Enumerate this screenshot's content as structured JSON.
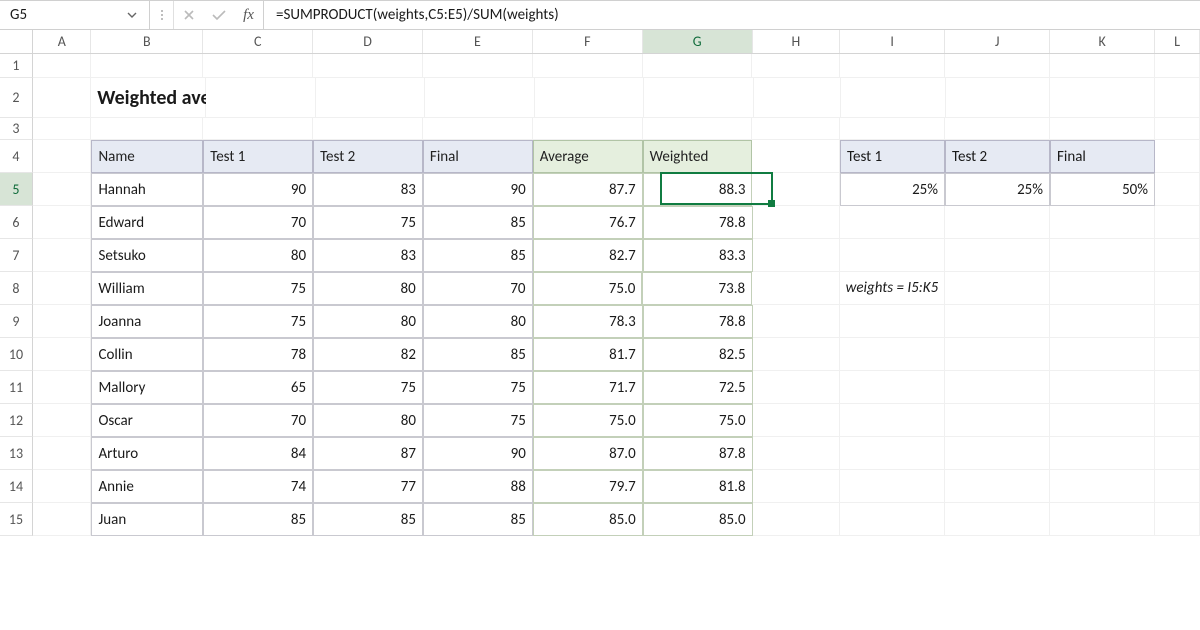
{
  "formula_bar": {
    "cell_ref": "G5",
    "formula": "=SUMPRODUCT(weights,C5:E5)/SUM(weights)",
    "fx_label": "fx"
  },
  "columns": [
    {
      "letter": "A",
      "width": 60
    },
    {
      "letter": "B",
      "width": 115
    },
    {
      "letter": "C",
      "width": 113
    },
    {
      "letter": "D",
      "width": 113
    },
    {
      "letter": "E",
      "width": 113
    },
    {
      "letter": "F",
      "width": 113
    },
    {
      "letter": "G",
      "width": 113
    },
    {
      "letter": "H",
      "width": 90
    },
    {
      "letter": "I",
      "width": 108
    },
    {
      "letter": "J",
      "width": 108
    },
    {
      "letter": "K",
      "width": 108
    },
    {
      "letter": "L",
      "width": 46
    }
  ],
  "active_col": "G",
  "active_row": 5,
  "title": "Weighted average",
  "table": {
    "headers": [
      "Name",
      "Test 1",
      "Test 2",
      "Final",
      "Average",
      "Weighted"
    ],
    "rows": [
      {
        "name": "Hannah",
        "t1": "90",
        "t2": "83",
        "fin": "90",
        "avg": "87.7",
        "wgt": "88.3"
      },
      {
        "name": "Edward",
        "t1": "70",
        "t2": "75",
        "fin": "85",
        "avg": "76.7",
        "wgt": "78.8"
      },
      {
        "name": "Setsuko",
        "t1": "80",
        "t2": "83",
        "fin": "85",
        "avg": "82.7",
        "wgt": "83.3"
      },
      {
        "name": "William",
        "t1": "75",
        "t2": "80",
        "fin": "70",
        "avg": "75.0",
        "wgt": "73.8"
      },
      {
        "name": "Joanna",
        "t1": "75",
        "t2": "80",
        "fin": "80",
        "avg": "78.3",
        "wgt": "78.8"
      },
      {
        "name": "Collin",
        "t1": "78",
        "t2": "82",
        "fin": "85",
        "avg": "81.7",
        "wgt": "82.5"
      },
      {
        "name": "Mallory",
        "t1": "65",
        "t2": "75",
        "fin": "75",
        "avg": "71.7",
        "wgt": "72.5"
      },
      {
        "name": "Oscar",
        "t1": "70",
        "t2": "80",
        "fin": "75",
        "avg": "75.0",
        "wgt": "75.0"
      },
      {
        "name": "Arturo",
        "t1": "84",
        "t2": "87",
        "fin": "90",
        "avg": "87.0",
        "wgt": "87.8"
      },
      {
        "name": "Annie",
        "t1": "74",
        "t2": "77",
        "fin": "88",
        "avg": "79.7",
        "wgt": "81.8"
      },
      {
        "name": "Juan",
        "t1": "85",
        "t2": "85",
        "fin": "85",
        "avg": "85.0",
        "wgt": "85.0"
      }
    ]
  },
  "weights_table": {
    "headers": [
      "Test 1",
      "Test 2",
      "Final"
    ],
    "values": [
      "25%",
      "25%",
      "50%"
    ]
  },
  "note": "weights = I5:K5",
  "chart_data": {
    "type": "table",
    "title": "Weighted average",
    "main_table": {
      "columns": [
        "Name",
        "Test 1",
        "Test 2",
        "Final",
        "Average",
        "Weighted"
      ],
      "rows": [
        [
          "Hannah",
          90,
          83,
          90,
          87.7,
          88.3
        ],
        [
          "Edward",
          70,
          75,
          85,
          76.7,
          78.8
        ],
        [
          "Setsuko",
          80,
          83,
          85,
          82.7,
          83.3
        ],
        [
          "William",
          75,
          80,
          70,
          75.0,
          73.8
        ],
        [
          "Joanna",
          75,
          80,
          80,
          78.3,
          78.8
        ],
        [
          "Collin",
          78,
          82,
          85,
          81.7,
          82.5
        ],
        [
          "Mallory",
          65,
          75,
          75,
          71.7,
          72.5
        ],
        [
          "Oscar",
          70,
          80,
          75,
          75.0,
          75.0
        ],
        [
          "Arturo",
          84,
          87,
          90,
          87.0,
          87.8
        ],
        [
          "Annie",
          74,
          77,
          88,
          79.7,
          81.8
        ],
        [
          "Juan",
          85,
          85,
          85,
          85.0,
          85.0
        ]
      ]
    },
    "weights": {
      "Test 1": 0.25,
      "Test 2": 0.25,
      "Final": 0.5
    },
    "formula": "=SUMPRODUCT(weights,C5:E5)/SUM(weights)",
    "named_range": "weights = I5:K5"
  }
}
